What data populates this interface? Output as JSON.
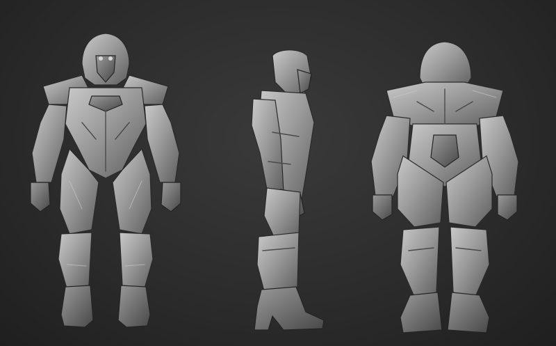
{
  "scene": {
    "background_color": "#2c2c2c",
    "material_color": "#9a9a9a",
    "views": [
      {
        "id": "front",
        "label": ""
      },
      {
        "id": "side",
        "label": ""
      },
      {
        "id": "back",
        "label": ""
      }
    ]
  }
}
